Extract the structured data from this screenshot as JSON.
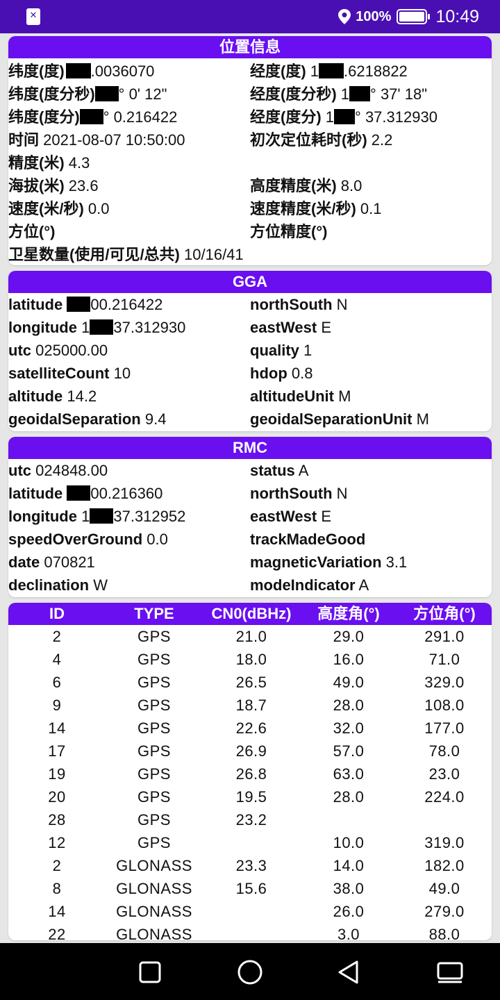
{
  "status_bar": {
    "battery": "100%",
    "time": "10:49"
  },
  "location": {
    "header": "位置信息",
    "lat_deg": {
      "label": "纬度(度)",
      "value": ".0036070"
    },
    "lon_deg": {
      "label": "经度(度)",
      "prefix": "1",
      "value": ".6218822"
    },
    "lat_dms": {
      "label": "纬度(度分秒)",
      "value": "° 0' 12\""
    },
    "lon_dms": {
      "label": "经度(度分秒)",
      "prefix": "1",
      "value": "° 37' 18\""
    },
    "lat_dm": {
      "label": "纬度(度分)",
      "value": "° 0.216422"
    },
    "lon_dm": {
      "label": "经度(度分)",
      "prefix": "1",
      "value": "° 37.312930"
    },
    "time": {
      "label": "时间",
      "value": "2021-08-07 10:50:00"
    },
    "ttff": {
      "label": "初次定位耗时(秒)",
      "value": "2.2"
    },
    "accuracy": {
      "label": "精度(米)",
      "value": "4.3"
    },
    "altitude": {
      "label": "海拔(米)",
      "value": "23.6"
    },
    "alt_accuracy": {
      "label": "高度精度(米)",
      "value": "8.0"
    },
    "speed": {
      "label": "速度(米/秒)",
      "value": "0.0"
    },
    "speed_accuracy": {
      "label": "速度精度(米/秒)",
      "value": "0.1"
    },
    "bearing": {
      "label": "方位(°)",
      "value": ""
    },
    "bearing_accuracy": {
      "label": "方位精度(°)",
      "value": ""
    },
    "satellites": {
      "label": "卫星数量(使用/可见/总共)",
      "value": "10/16/41"
    }
  },
  "gga": {
    "header": "GGA",
    "latitude": {
      "label": "latitude",
      "value": "00.216422"
    },
    "northSouth": {
      "label": "northSouth",
      "value": "N"
    },
    "longitude": {
      "label": "longitude",
      "prefix": "1",
      "value": "37.312930"
    },
    "eastWest": {
      "label": "eastWest",
      "value": "E"
    },
    "utc": {
      "label": "utc",
      "value": "025000.00"
    },
    "quality": {
      "label": "quality",
      "value": "1"
    },
    "satelliteCount": {
      "label": "satelliteCount",
      "value": "10"
    },
    "hdop": {
      "label": "hdop",
      "value": "0.8"
    },
    "altitude": {
      "label": "altitude",
      "value": "14.2"
    },
    "altitudeUnit": {
      "label": "altitudeUnit",
      "value": "M"
    },
    "geoidalSeparation": {
      "label": "geoidalSeparation",
      "value": "9.4"
    },
    "geoidalSeparationUnit": {
      "label": "geoidalSeparationUnit",
      "value": "M"
    }
  },
  "rmc": {
    "header": "RMC",
    "utc": {
      "label": "utc",
      "value": "024848.00"
    },
    "status": {
      "label": "status",
      "value": "A"
    },
    "latitude": {
      "label": "latitude",
      "value": "00.216360"
    },
    "northSouth": {
      "label": "northSouth",
      "value": "N"
    },
    "longitude": {
      "label": "longitude",
      "prefix": "1",
      "value": "37.312952"
    },
    "eastWest": {
      "label": "eastWest",
      "value": "E"
    },
    "speedOverGround": {
      "label": "speedOverGround",
      "value": "0.0"
    },
    "trackMadeGood": {
      "label": "trackMadeGood",
      "value": ""
    },
    "date": {
      "label": "date",
      "value": "070821"
    },
    "magneticVariation": {
      "label": "magneticVariation",
      "value": "3.1"
    },
    "declination": {
      "label": "declination",
      "value": "W"
    },
    "modeIndicator": {
      "label": "modeIndicator",
      "value": "A"
    }
  },
  "satellites": {
    "columns": [
      "ID",
      "TYPE",
      "CN0(dBHz)",
      "高度角(°)",
      "方位角(°)"
    ],
    "rows": [
      [
        "2",
        "GPS",
        "21.0",
        "29.0",
        "291.0"
      ],
      [
        "4",
        "GPS",
        "18.0",
        "16.0",
        "71.0"
      ],
      [
        "6",
        "GPS",
        "26.5",
        "49.0",
        "329.0"
      ],
      [
        "9",
        "GPS",
        "18.7",
        "28.0",
        "108.0"
      ],
      [
        "14",
        "GPS",
        "22.6",
        "32.0",
        "177.0"
      ],
      [
        "17",
        "GPS",
        "26.9",
        "57.0",
        "78.0"
      ],
      [
        "19",
        "GPS",
        "26.8",
        "63.0",
        "23.0"
      ],
      [
        "20",
        "GPS",
        "19.5",
        "28.0",
        "224.0"
      ],
      [
        "28",
        "GPS",
        "23.2",
        "",
        ""
      ],
      [
        "12",
        "GPS",
        "",
        "10.0",
        "319.0"
      ],
      [
        "2",
        "GLONASS",
        "23.3",
        "14.0",
        "182.0"
      ],
      [
        "8",
        "GLONASS",
        "15.6",
        "38.0",
        "49.0"
      ],
      [
        "14",
        "GLONASS",
        "",
        "26.0",
        "279.0"
      ],
      [
        "22",
        "GLONASS",
        "",
        "3.0",
        "88.0"
      ]
    ]
  },
  "colors": {
    "status_bar": "#4a0fb3",
    "header": "#6a0ff0"
  },
  "icons": [
    "app-notification-icon",
    "location-icon",
    "battery-icon",
    "square-recents-icon",
    "circle-home-icon",
    "triangle-back-icon",
    "keyboard-icon"
  ]
}
